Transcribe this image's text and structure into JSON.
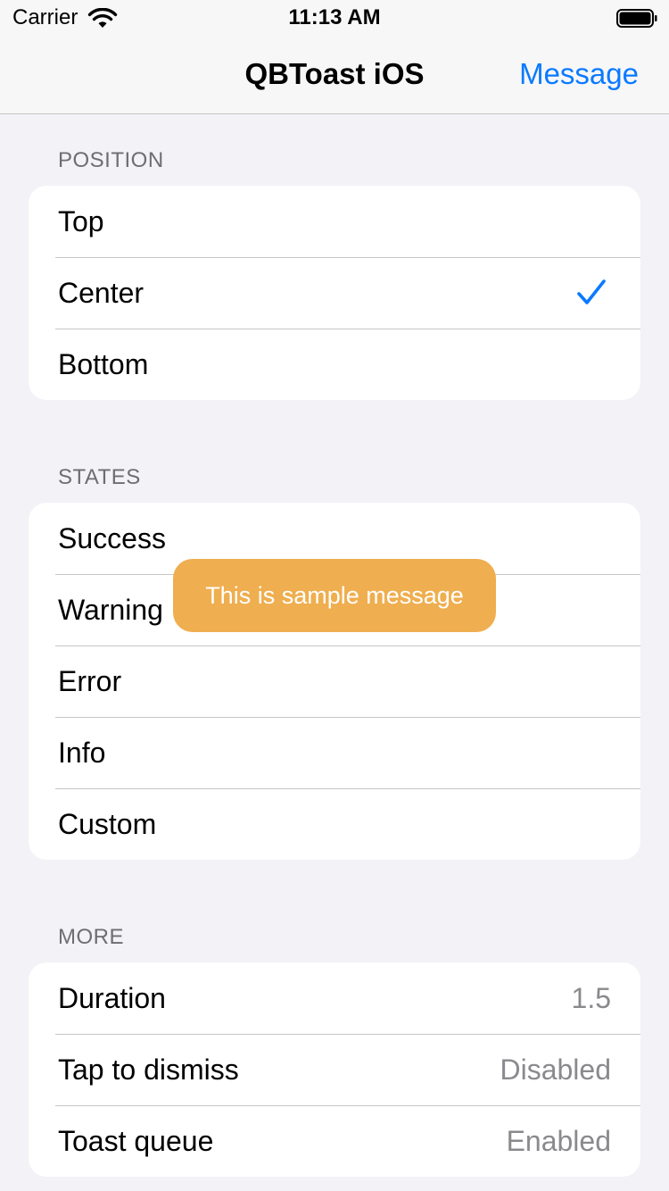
{
  "status_bar": {
    "carrier": "Carrier",
    "time": "11:13 AM",
    "wifi_icon": "wifi-icon",
    "battery_icon": "battery-icon"
  },
  "nav": {
    "title": "QBToast iOS",
    "action_label": "Message"
  },
  "sections": {
    "position": {
      "header": "POSITION",
      "items": [
        {
          "label": "Top",
          "selected": false
        },
        {
          "label": "Center",
          "selected": true
        },
        {
          "label": "Bottom",
          "selected": false
        }
      ]
    },
    "states": {
      "header": "STATES",
      "items": [
        {
          "label": "Success"
        },
        {
          "label": "Warning"
        },
        {
          "label": "Error"
        },
        {
          "label": "Info"
        },
        {
          "label": "Custom"
        }
      ]
    },
    "more": {
      "header": "MORE",
      "items": [
        {
          "label": "Duration",
          "value": "1.5"
        },
        {
          "label": "Tap to dismiss",
          "value": "Disabled"
        },
        {
          "label": "Toast queue",
          "value": "Enabled"
        }
      ]
    }
  },
  "toast": {
    "message": "This is sample message",
    "color": "#efae4f"
  },
  "colors": {
    "accent": "#0a7aff",
    "background": "#f2f2f7",
    "secondary_text": "#8a8a8e"
  }
}
